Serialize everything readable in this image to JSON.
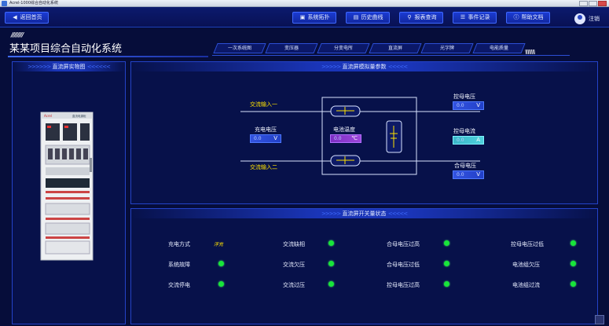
{
  "window": {
    "title": "Acrel-1000综合自动化系统"
  },
  "topnav": {
    "home": "返回首页",
    "buttons": {
      "topology": "系统拓扑",
      "history": "历史曲线",
      "report": "报表查询",
      "events": "事件记录",
      "help": "帮助文档"
    },
    "logout": "注销"
  },
  "header": {
    "title": "某某项目综合自动化系统",
    "tabs": [
      "一次系统图",
      "变压器",
      "分变电所",
      "直流屏",
      "光字牌",
      "电能质量"
    ]
  },
  "panels": {
    "photo_title": "直流屏实物图",
    "sim_title": "直流屏模拟量参数",
    "switch_title": "直流屏开关量状态"
  },
  "cabinet": {
    "brand": "Acrel",
    "model": "直流电源柜"
  },
  "sim": {
    "ac_in_1": "交流输入一",
    "ac_in_2": "交流输入二",
    "charge_voltage": {
      "label": "充电电压",
      "value": "0.0",
      "unit": "V"
    },
    "battery_temp": {
      "label": "电池温度",
      "value": "0.0",
      "unit": "℃"
    },
    "ctrl_bus_voltage": {
      "label": "控母电压",
      "value": "0.0",
      "unit": "V"
    },
    "ctrl_bus_current": {
      "label": "控母电流",
      "value": "0.0",
      "unit": "A"
    },
    "combined_bus_voltage": {
      "label": "合母电压",
      "value": "0.0",
      "unit": "V"
    }
  },
  "switch_status": {
    "charge_mode_label": "充电方式",
    "charge_mode_value": "浮充",
    "items": [
      {
        "label": "交流缺相",
        "state": "normal"
      },
      {
        "label": "合母电压过高",
        "state": "normal"
      },
      {
        "label": "控母电压过低",
        "state": "normal"
      },
      {
        "label": "系统故障",
        "state": "normal"
      },
      {
        "label": "交流欠压",
        "state": "normal"
      },
      {
        "label": "合母电压过低",
        "state": "normal"
      },
      {
        "label": "电池组欠压",
        "state": "normal"
      },
      {
        "label": "交流停电",
        "state": "normal"
      },
      {
        "label": "交流过压",
        "state": "normal"
      },
      {
        "label": "控母电压过高",
        "state": "normal"
      },
      {
        "label": "电池组过流",
        "state": "normal"
      }
    ]
  },
  "colors": {
    "background": "#060d3a",
    "accent": "#2443c9",
    "status_ok": "#18e63a",
    "label_yellow": "#ffe200"
  },
  "icons": {
    "home": "back-arrow-icon",
    "topology": "topology-icon",
    "history": "chart-icon",
    "report": "search-icon",
    "events": "document-icon",
    "help": "help-circle-icon",
    "user": "user-avatar-icon"
  }
}
